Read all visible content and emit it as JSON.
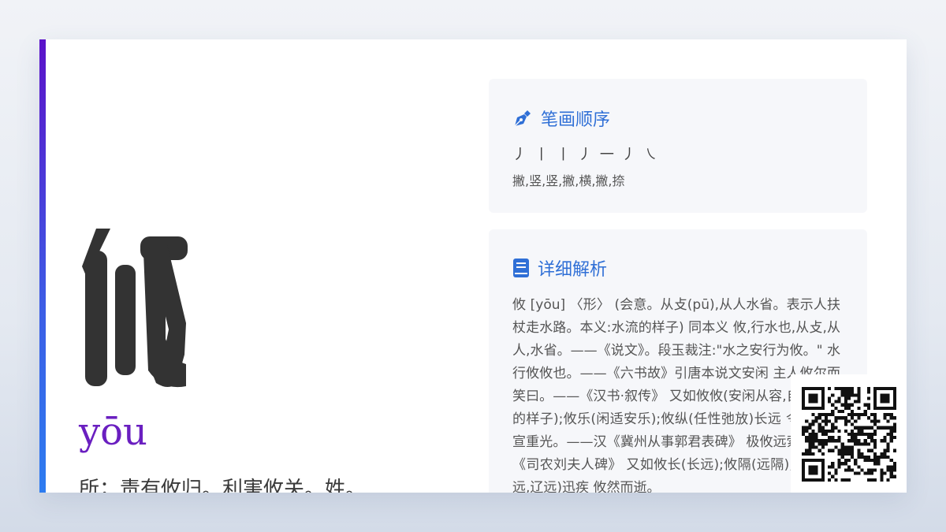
{
  "character": "攸",
  "pinyin": "yōu",
  "meaning": "所；责有攸归。利害攸关。姓。",
  "strokes_panel": {
    "title": "笔画顺序",
    "icon": "pen-nib-icon",
    "glyphs": "丿 丨 丨 丿 一 丿 ㇏",
    "names": "撇,竖,竖,撇,横,撇,捺"
  },
  "detail_panel": {
    "title": "详细解析",
    "icon": "book-icon",
    "text": "攸 [yōu] 〈形〉 (会意。从攴(pū),从人水省。表示人扶杖走水路。本义:水流的样子) 同本义 攸,行水也,从攴,从人,水省。——《说文》。段玉裁注:\"水之安行为攸。\" 水行攸攸也。——《六书故》引唐本说文安闲 主人攸尔而笑曰。——《汉书·叙传》 又如攸攸(安闲从容,自得其乐的样子);攸乐(闲适安乐);攸纵(任性弛放)长远 令德攸兮宣重光。——汉《冀州从事郭君表碑》 极攸远索。——《司农刘夫人碑》 又如攸长(长远);攸隔(远隔);攸远(遥远,辽远)迅疾 攸然而逝。"
  },
  "colors": {
    "accent_top": "#5b12c9",
    "accent_bottom": "#2d7cf0",
    "pinyin": "#6a1fc0",
    "panel_title": "#2f6fd6"
  }
}
